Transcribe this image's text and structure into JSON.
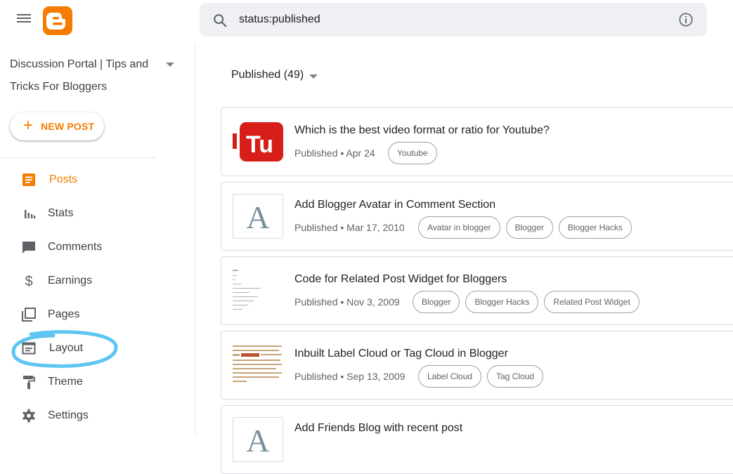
{
  "colors": {
    "accent": "#f57c00",
    "highlight": "#5ec6f2"
  },
  "header": {
    "search_value": "status:published",
    "menu_icon": "hamburger-menu-icon",
    "logo_icon": "blogger-logo-icon",
    "search_icon": "search-icon",
    "info_icon": "info-icon"
  },
  "sidebar": {
    "blog_title": "Discussion Portal | Tips and Tricks For Bloggers",
    "new_post": {
      "plus": "+",
      "label": "NEW POST"
    },
    "items": [
      {
        "label": "Posts",
        "icon": "posts-icon",
        "active": true
      },
      {
        "label": "Stats",
        "icon": "stats-icon",
        "active": false
      },
      {
        "label": "Comments",
        "icon": "comment-icon",
        "active": false
      },
      {
        "label": "Earnings",
        "icon": "dollar-icon",
        "active": false
      },
      {
        "label": "Pages",
        "icon": "pages-icon",
        "active": false
      },
      {
        "label": "Layout",
        "icon": "layout-icon",
        "active": false
      },
      {
        "label": "Theme",
        "icon": "paint-roller-icon",
        "active": false
      },
      {
        "label": "Settings",
        "icon": "gear-icon",
        "active": false
      }
    ]
  },
  "main": {
    "filter_label": "Published (49)",
    "posts": [
      {
        "title": "Which is the best video format or ratio for Youtube?",
        "meta": "Published • Apr 24",
        "tags": [
          "Youtube"
        ],
        "thumb": "youtube-thumbnail"
      },
      {
        "title": "Add Blogger Avatar in Comment Section",
        "meta": "Published • Mar 17, 2010",
        "tags": [
          "Avatar in blogger",
          "Blogger",
          "Blogger Hacks"
        ],
        "thumb": "letter-thumbnail",
        "thumb_letter": "A"
      },
      {
        "title": "Code for Related Post Widget for Bloggers",
        "meta": "Published • Nov 3, 2009",
        "tags": [
          "Blogger",
          "Blogger Hacks",
          "Related Post Widget"
        ],
        "thumb": "screenshot-thumbnail"
      },
      {
        "title": "Inbuilt Label Cloud or Tag Cloud in Blogger",
        "meta": "Published • Sep 13, 2009",
        "tags": [
          "Label Cloud",
          "Tag Cloud"
        ],
        "thumb": "label-cloud-thumbnail"
      },
      {
        "title": "Add Friends Blog with recent post",
        "meta": "",
        "tags": [],
        "thumb": "letter-thumbnail",
        "thumb_letter": "A"
      }
    ]
  }
}
